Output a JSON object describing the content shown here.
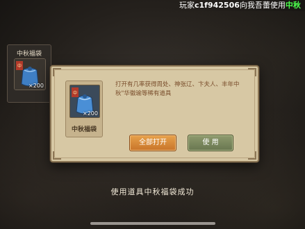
{
  "broadcast": {
    "prefix": "玩家",
    "username": "c1f942506",
    "message": "向我吾蕾使用",
    "highlight": "中秋"
  },
  "inventory_slot": {
    "title": "中秋福袋",
    "quantity": "×200"
  },
  "dialog": {
    "item_name": "中秋福袋",
    "quantity": "×200",
    "description": "打开有几率获得周处、神张辽、卞夫人、丰年中秋\"华徽瑜等稀有道具",
    "open_all_label": "全部打开",
    "use_label": "使 用"
  },
  "toast": "使用道具中秋福袋成功",
  "colors": {
    "dialog_bg": "#d7c8a4",
    "open_all_btn": "#d98a3a",
    "use_btn": "#7b8860",
    "description_text": "#7a4e2c",
    "highlight_text": "#4cff4c"
  },
  "icons": {
    "bag": "blue-lucky-bag-icon",
    "bag_tag": "red-tag-icon"
  }
}
